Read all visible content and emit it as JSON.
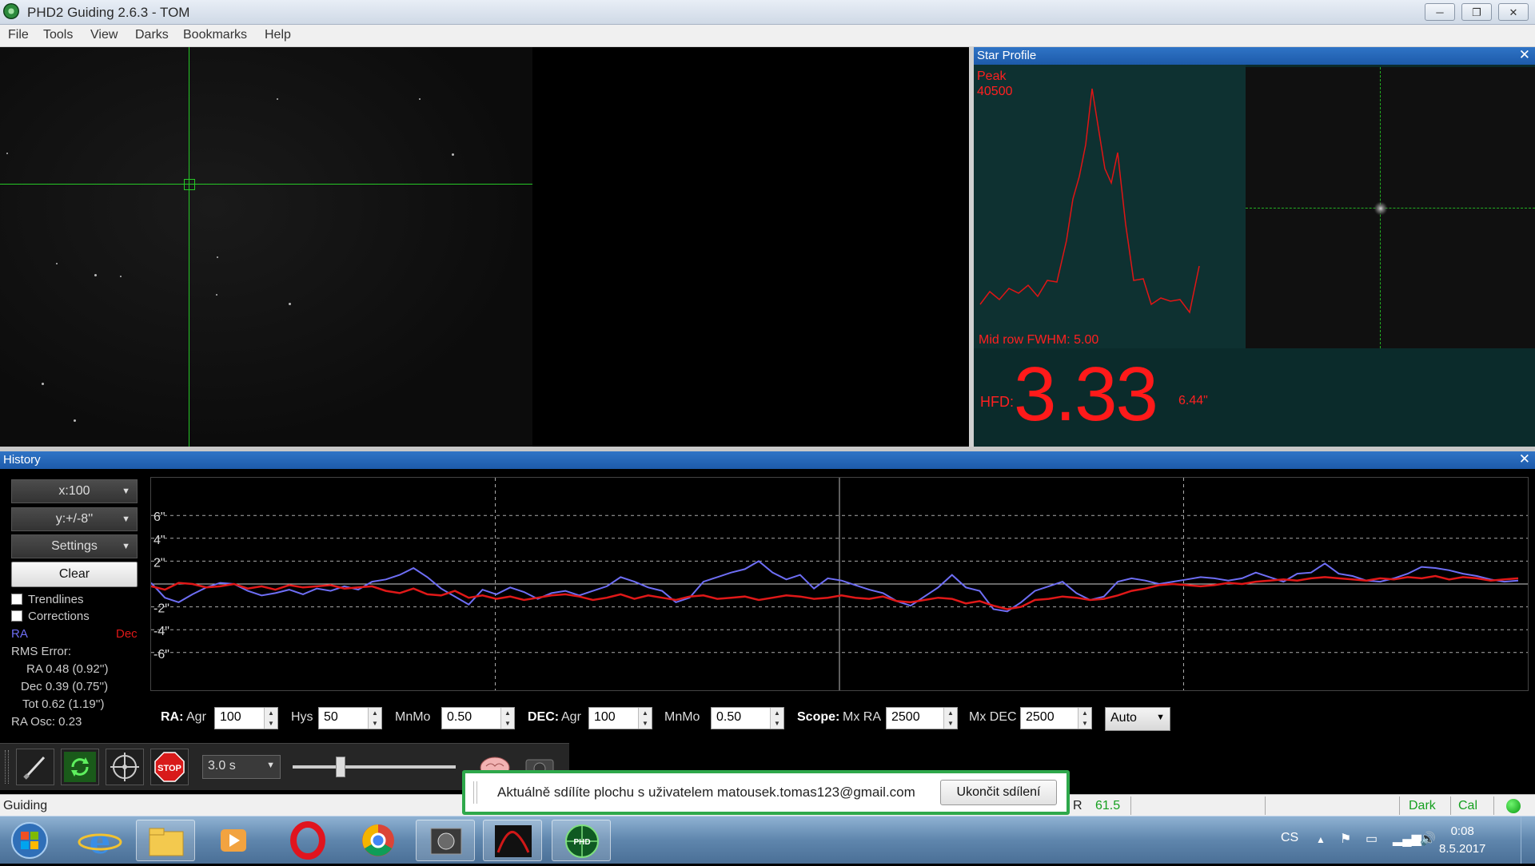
{
  "window": {
    "title": "PHD2 Guiding 2.6.3 - TOM",
    "controls": [
      "minimize",
      "restore",
      "close"
    ]
  },
  "menu": [
    "File",
    "Tools",
    "View",
    "Darks",
    "Bookmarks",
    "Help"
  ],
  "star_profile": {
    "title": "Star Profile",
    "peak_label": "Peak",
    "peak_value": "40500",
    "fwhm_text": "Mid row FWHM: 5.00",
    "hfd_label": "HFD:",
    "hfd_value": "3.33",
    "hfd_arcsec": "6.44\""
  },
  "history": {
    "title": "History",
    "x_scale": "x:100",
    "y_scale": "y:+/-8''",
    "settings_label": "Settings",
    "clear_label": "Clear",
    "trendlines_label": "Trendlines",
    "corrections_label": "Corrections",
    "ra_label": "RA",
    "dec_label": "Dec",
    "rms_label": "RMS Error:",
    "ra_rms": "RA 0.48 (0.92'')",
    "dec_rms": "Dec 0.39 (0.75'')",
    "tot_rms": "Tot 0.62 (1.19'')",
    "ra_osc": "RA Osc: 0.23",
    "y_ticks": [
      "6\"",
      "4\"",
      "2\"",
      "-2\"",
      "-4\"",
      "-6\""
    ],
    "colors": {
      "ra": "#6e6ef5",
      "dec": "#e01818"
    }
  },
  "chart_data": {
    "type": "line",
    "ylim": [
      -8,
      8
    ],
    "y_ticks": [
      6,
      4,
      2,
      -2,
      -4,
      -6
    ],
    "x_count": 100,
    "series": [
      {
        "name": "RA",
        "values": [
          0.1,
          -1.2,
          -1.6,
          -0.9,
          -0.3,
          0.1,
          0,
          -0.6,
          -1.0,
          -0.8,
          -0.5,
          -0.9,
          -0.4,
          -0.6,
          -0.2,
          -0.5,
          0.2,
          0.4,
          0.8,
          1.4,
          0.6,
          -0.4,
          -1.1,
          -1.8,
          -0.5,
          -0.9,
          -0.3,
          -0.7,
          -1.3,
          -0.8,
          -0.6,
          -1.0,
          -0.6,
          -0.2,
          0.6,
          0.2,
          -0.3,
          -0.6,
          -1.6,
          -1.2,
          0.2,
          0.6,
          1.0,
          1.3,
          2.0,
          1.0,
          0.4,
          0.8,
          -0.4,
          0.5,
          0.3,
          -0.1,
          -0.5,
          -0.8,
          -1.5,
          -1.9,
          -1.1,
          -0.3,
          0.8,
          -0.3,
          -0.6,
          -2.2,
          -2.4,
          -1.6,
          -0.6,
          -0.2,
          0.2,
          -0.8,
          -1.4,
          -1.1,
          0.2,
          0.5,
          0.3,
          0,
          0.2,
          0.4,
          0.6,
          0.5,
          0.3,
          0.5,
          1.0,
          0.6,
          0.2,
          0.9,
          1.0,
          1.8,
          0.9,
          0.7,
          0.3,
          0.2,
          0.5,
          0.9,
          1.5,
          1.4,
          1.2,
          0.9,
          0.7,
          0.4,
          0.2,
          0.3
        ]
      },
      {
        "name": "Dec",
        "values": [
          -0.2,
          -0.5,
          0.1,
          0,
          -0.3,
          -0.2,
          0,
          -0.4,
          -0.2,
          -0.5,
          -0.1,
          -0.3,
          -0.2,
          -0.1,
          -0.4,
          -0.3,
          -0.2,
          -0.6,
          -0.8,
          -0.4,
          -0.9,
          -1.0,
          -0.6,
          -1.2,
          -1.0,
          -1.3,
          -1.1,
          -1.4,
          -1.2,
          -1.0,
          -0.9,
          -1.1,
          -1.4,
          -1.2,
          -0.9,
          -1.3,
          -1.0,
          -1.2,
          -1.4,
          -1.1,
          -1.0,
          -1.3,
          -1.2,
          -1.1,
          -1.4,
          -1.2,
          -1.0,
          -1.1,
          -1.3,
          -1.2,
          -1.0,
          -1.2,
          -1.3,
          -1.1,
          -1.5,
          -1.6,
          -1.4,
          -1.2,
          -1.3,
          -1.7,
          -1.5,
          -1.9,
          -2.2,
          -2.0,
          -1.4,
          -1.3,
          -1.1,
          -1.2,
          -1.4,
          -1.3,
          -1.0,
          -0.6,
          -0.4,
          -0.1,
          0,
          -0.1,
          -0.2,
          -0.1,
          0.1,
          0,
          0.2,
          0.3,
          0.4,
          0.3,
          0.5,
          0.6,
          0.5,
          0.4,
          0.3,
          0.5,
          0.4,
          0.6,
          0.5,
          0.7,
          0.4,
          0.6,
          0.5,
          0.3,
          0.4,
          0.5
        ]
      }
    ]
  },
  "brain_controls": {
    "ra_group": "RA:",
    "ra_agr_label": "Agr",
    "ra_agr_value": "100",
    "hys_label": "Hys",
    "hys_value": "50",
    "ra_mnmo_label": "MnMo",
    "ra_mnmo_value": "0.50",
    "dec_group": "DEC:",
    "dec_agr_label": "Agr",
    "dec_agr_value": "100",
    "dec_mnmo_label": "MnMo",
    "dec_mnmo_value": "0.50",
    "scope_group": "Scope:",
    "mxra_label": "Mx RA",
    "mxra_value": "2500",
    "mxdec_label": "Mx DEC",
    "mxdec_value": "2500",
    "dec_mode": "Auto"
  },
  "toolbar": {
    "exposure_value": "3.0 s",
    "icons": [
      "equipment-icon",
      "loop-icon",
      "guide-icon",
      "stop-icon",
      "brain-icon",
      "camera-icon"
    ],
    "exposure_slider_fraction": 0.25
  },
  "status": {
    "state": "Guiding",
    "snr_label": "R",
    "snr_value": "61.5",
    "dark_label": "Dark",
    "cal_label": "Cal",
    "led_color": "#10c020"
  },
  "sharing": {
    "message": "Aktuálně sdílíte plochu s uživatelem matousek.tomas123@gmail.com",
    "stop_label": "Ukončit sdílení"
  },
  "taskbar": {
    "apps": [
      "start-orb",
      "internet-explorer",
      "file-explorer",
      "media-player",
      "opera",
      "chrome",
      "camera-app",
      "app-red-curve",
      "phd2"
    ],
    "lang": "CS",
    "time": "0:08",
    "date": "8.5.2017"
  }
}
